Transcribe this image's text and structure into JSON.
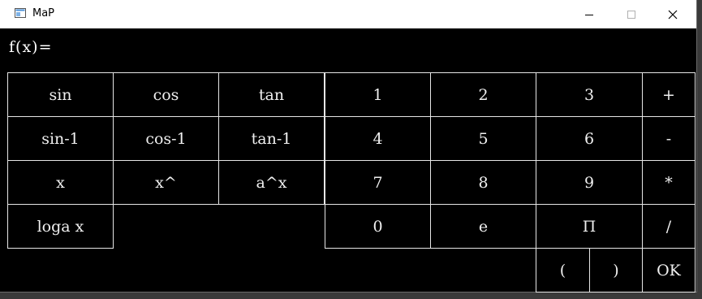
{
  "window": {
    "title": "MaP"
  },
  "expression": {
    "label": "f(x)="
  },
  "keys": {
    "sin": "sin",
    "cos": "cos",
    "tan": "tan",
    "asin": "sin-1",
    "acos": "cos-1",
    "atan": "tan-1",
    "x": "x",
    "x_pow": "x^",
    "a_pow_x": "a^x",
    "loga": "loga x",
    "n1": "1",
    "n2": "2",
    "n3": "3",
    "n4": "4",
    "n5": "5",
    "n6": "6",
    "n7": "7",
    "n8": "8",
    "n9": "9",
    "n0": "0",
    "e": "e",
    "pi": "Π",
    "plus": "+",
    "minus": "-",
    "times": "*",
    "divide": "/",
    "lparen": "(",
    "rparen": ")",
    "ok": "OK"
  }
}
